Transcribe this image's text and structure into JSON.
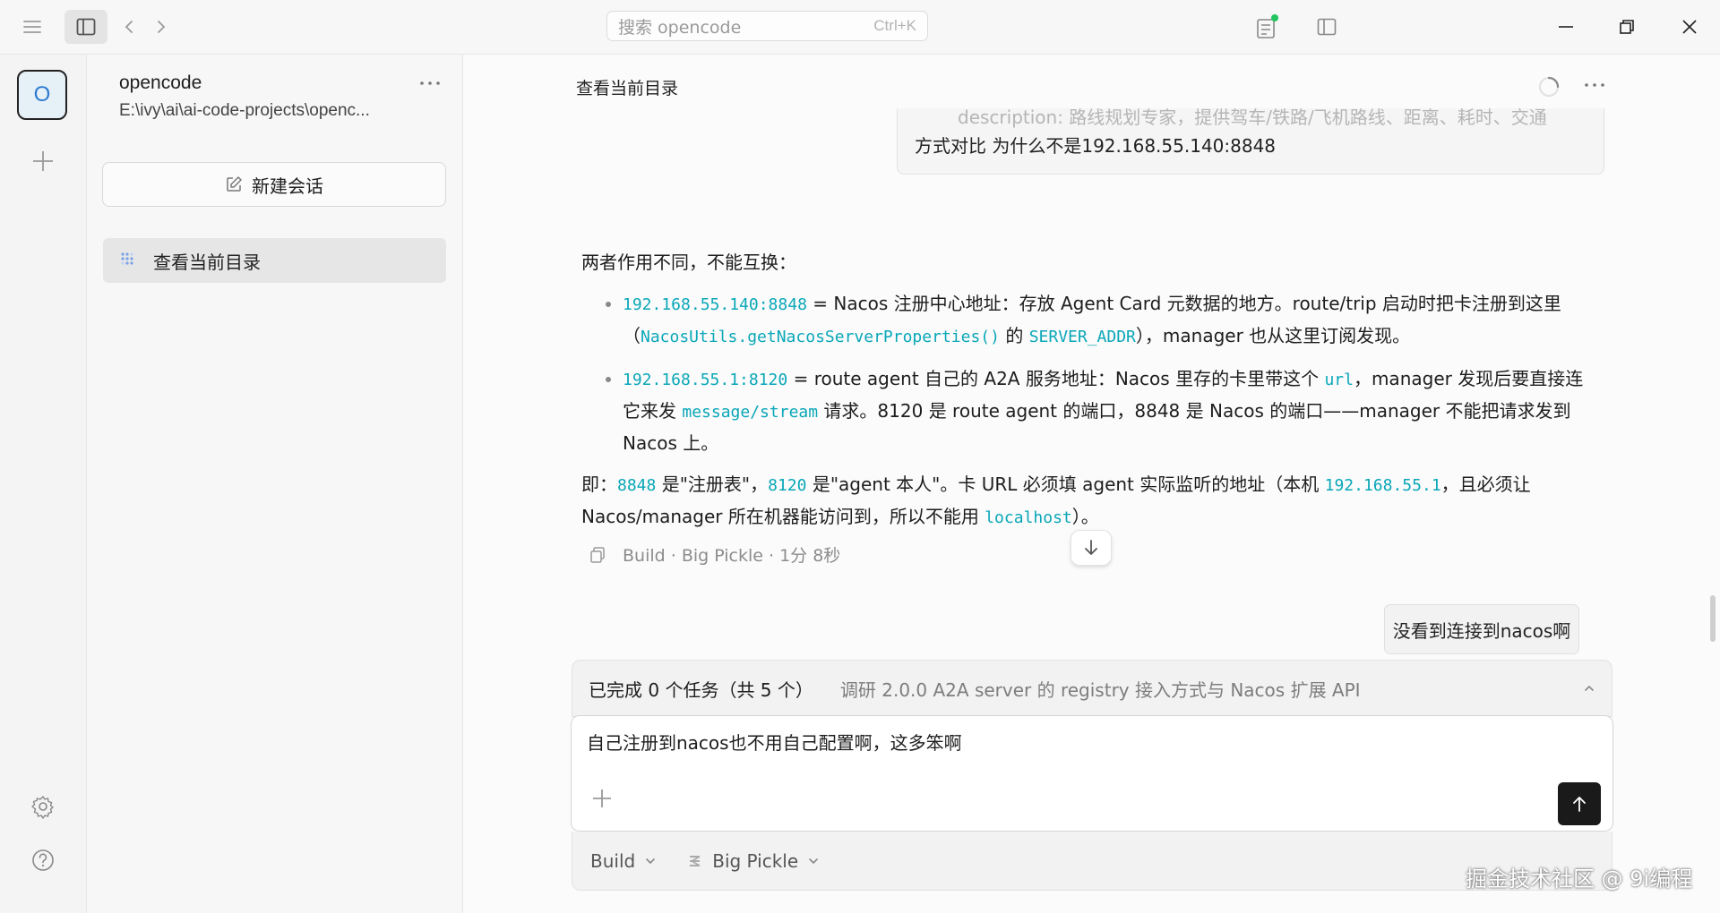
{
  "window": {
    "search_placeholder": "搜索 opencode",
    "search_shortcut": "Ctrl+K"
  },
  "rail": {
    "project_avatar_letter": "O"
  },
  "sidebar": {
    "project_name": "opencode",
    "project_path": "E:\\ivy\\ai\\ai-code-projects\\openc...",
    "new_session_label": "新建会话",
    "sessions": [
      {
        "title": "查看当前目录"
      }
    ]
  },
  "main": {
    "session_title": "查看当前目录",
    "previous_message": {
      "faded_line": "description: 路线规划专家，提供驾车/铁路/飞机路线、距离、耗时、交通",
      "line": "方式对比 为什么不是192.168.55.140:8848"
    },
    "answer": {
      "intro": "两者作用不同，不能互换：",
      "bullet1": {
        "code_addr": "192.168.55.140:8848",
        "text_a": " = Nacos 注册中心地址：存放 Agent Card 元数据的地方。route/trip 启动时把卡注册到这里（",
        "code_fn": "NacosUtils.getNacosServerProperties()",
        "text_b": " 的 ",
        "code_var": "SERVER_ADDR",
        "text_c": "），manager 也从这里订阅发现。"
      },
      "bullet2": {
        "code_addr": "192.168.55.1:8120",
        "text_a": " = route agent 自己的 A2A 服务地址：Nacos 里存的卡里带这个 ",
        "code_url": "url",
        "text_b": "，manager 发现后要直接连它来发 ",
        "code_path": "message/stream",
        "text_c": " 请求。8120 是 route agent 的端口，8848 是 Nacos 的端口——manager 不能把请求发到 Nacos 上。"
      },
      "summary": {
        "prefix": "即：",
        "code_8848": "8848",
        "text_a": " 是\"注册表\"，",
        "code_8120": "8120",
        "text_b": " 是\"agent 本人\"。卡 URL 必须填 agent 实际监听的地址（本机 ",
        "code_ip": "192.168.55.1",
        "text_c": "，且必须让 Nacos/manager 所在机器能访问到，所以不能用 ",
        "code_localhost": "localhost",
        "text_d": "）。"
      },
      "meta": "Build · Big Pickle · 1分 8秒"
    },
    "user_message": "没看到连接到nacos啊",
    "tasks": {
      "count_label": "已完成 0 个任务（共 5 个）",
      "current_task": "调研 2.0.0 A2A server 的 registry 接入方式与 Nacos 扩展 API"
    },
    "composer": {
      "text": "自己注册到nacos也不用自己配置啊，这多笨啊"
    },
    "bottom": {
      "agent": "Build",
      "model": "Big Pickle"
    }
  },
  "watermark": "掘金技术社区 @ 9i编程",
  "colors": {
    "code": "#0aa7b8",
    "status_dot": "#22c55e",
    "send_button": "#1a1a1a"
  }
}
